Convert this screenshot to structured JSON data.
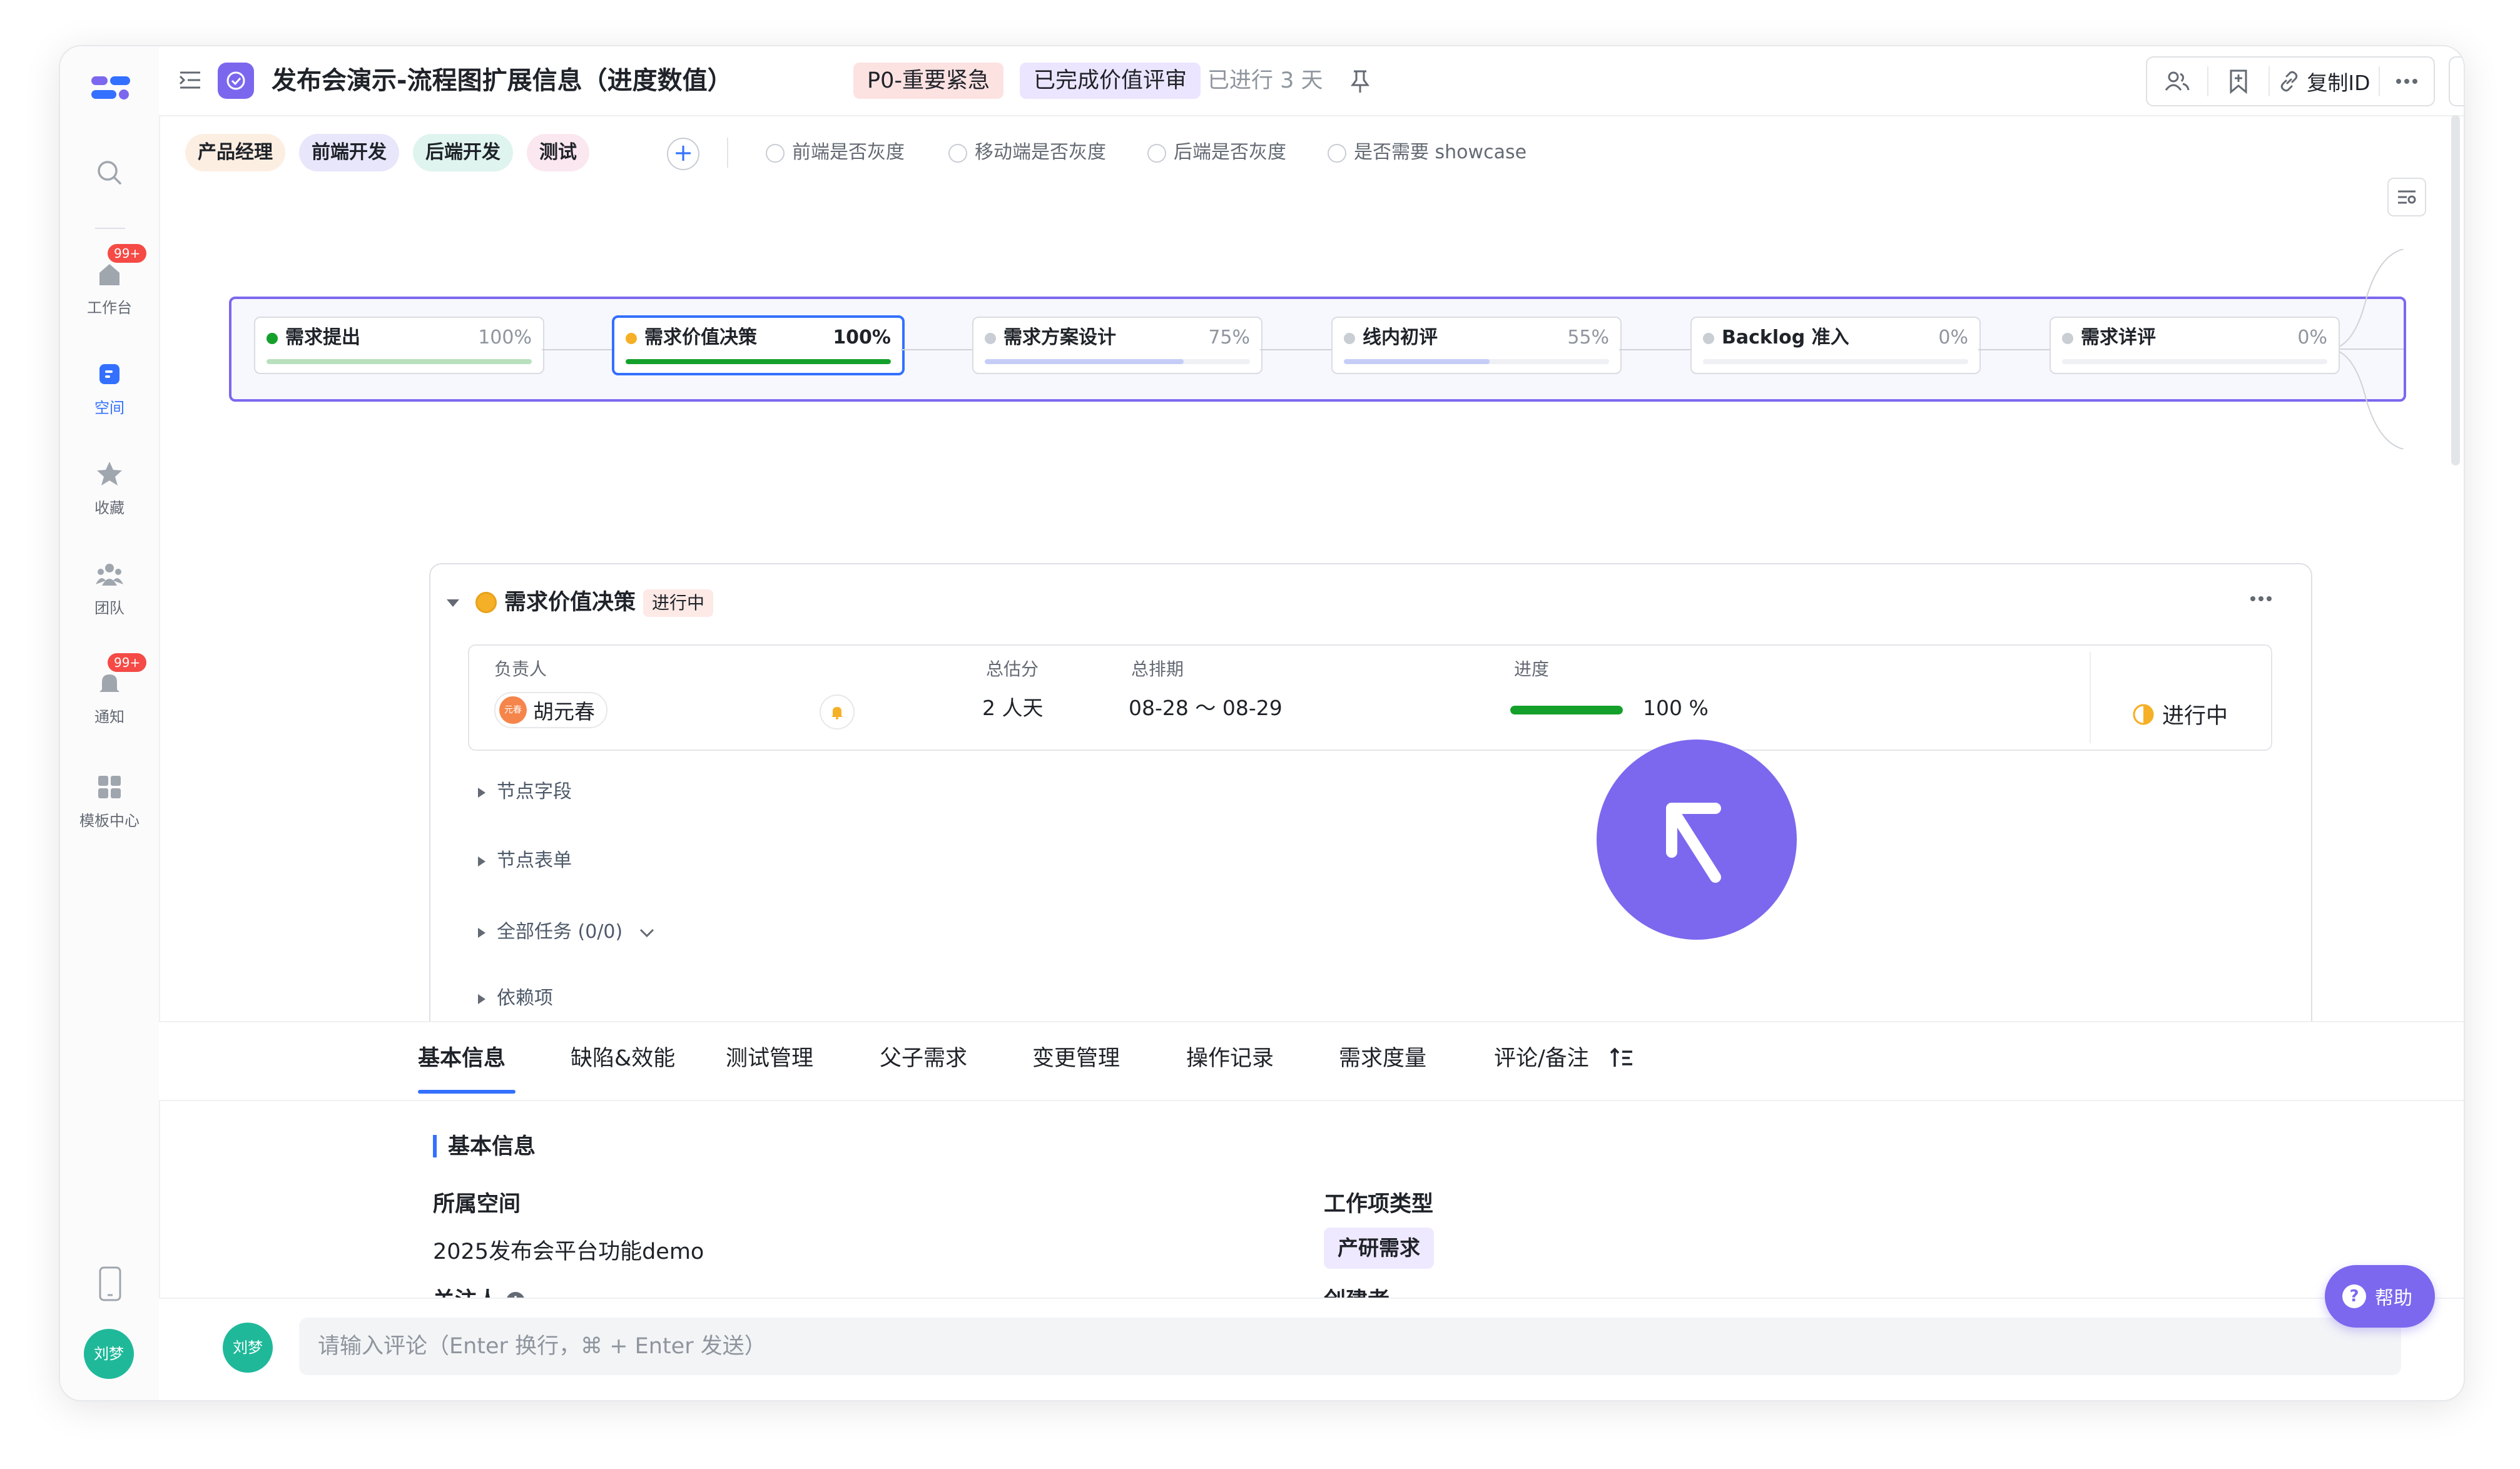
{
  "sidebar": {
    "items": [
      {
        "label": "",
        "icon": "search-icon"
      },
      {
        "label": "工作台",
        "icon": "home-icon",
        "badge": "99+"
      },
      {
        "label": "空间",
        "icon": "space-icon",
        "active": true
      },
      {
        "label": "收藏",
        "icon": "star-icon"
      },
      {
        "label": "团队",
        "icon": "team-icon"
      },
      {
        "label": "通知",
        "icon": "bell-icon",
        "badge": "99+"
      },
      {
        "label": "模板中心",
        "icon": "template-icon"
      }
    ],
    "user_initials": "刘梦"
  },
  "header": {
    "title": "发布会演示-流程图扩展信息（进度数值）",
    "priority_tag": "P0-重要紧急",
    "status_tag": "已完成价值评审",
    "elapsed": "已进行 3 天",
    "copy_id_label": "复制ID"
  },
  "roles": [
    {
      "label": "产品经理",
      "bg": "#fdeee2"
    },
    {
      "label": "前端开发",
      "bg": "#e8e6fb"
    },
    {
      "label": "后端开发",
      "bg": "#dff4ee"
    },
    {
      "label": "测试",
      "bg": "#fbe7f0"
    }
  ],
  "checks": [
    {
      "label": "前端是否灰度"
    },
    {
      "label": "移动端是否灰度"
    },
    {
      "label": "后端是否灰度"
    },
    {
      "label": "是否需要 showcase"
    }
  ],
  "flow": {
    "nodes": [
      {
        "name": "需求提出",
        "pct_label": "100%",
        "progress": 1.0,
        "dot": "#14a02a",
        "fill": "#b8e0bd",
        "active": false
      },
      {
        "name": "需求价值决策",
        "pct_label": "100%",
        "progress": 1.0,
        "dot": "#f5b027",
        "fill": "#14a02a",
        "active": true
      },
      {
        "name": "需求方案设计",
        "pct_label": "75%",
        "progress": 0.75,
        "dot": "#c9cdd4",
        "fill": "#c5cdf7",
        "active": false
      },
      {
        "name": "线内初评",
        "pct_label": "55%",
        "progress": 0.55,
        "dot": "#c9cdd4",
        "fill": "#c5cdf7",
        "active": false
      },
      {
        "name": "Backlog 准入",
        "pct_label": "0%",
        "progress": 0,
        "dot": "#c9cdd4",
        "fill": "#c5cdf7",
        "active": false
      },
      {
        "name": "需求详评",
        "pct_label": "0%",
        "progress": 0,
        "dot": "#c9cdd4",
        "fill": "#c5cdf7",
        "active": false
      }
    ]
  },
  "card": {
    "title": "需求价值决策",
    "status": "进行中",
    "headers": {
      "owner": "负责人",
      "estimate": "总估分",
      "schedule": "总排期",
      "progress": "进度"
    },
    "owner_avatar": "元春",
    "owner": "胡元春",
    "estimate": "2 人天",
    "schedule": "08-28 ～ 08-29",
    "progress_value": 1.0,
    "progress_label": "100 %",
    "right_status": "进行中",
    "sections": [
      "节点字段",
      "节点表单",
      "全部任务 (0/0)",
      "依赖项"
    ]
  },
  "tabs": [
    "基本信息",
    "缺陷&效能",
    "测试管理",
    "父子需求",
    "变更管理",
    "操作记录",
    "需求度量",
    "评论/备注"
  ],
  "basic_info": {
    "heading": "基本信息",
    "space_label": "所属空间",
    "space_value": "2025发布会平台功能demo",
    "type_label": "工作项类型",
    "type_value": "产研需求",
    "watchers_label": "关注人",
    "creator_label": "创建者"
  },
  "comment": {
    "avatar": "刘梦",
    "placeholder": "请输入评论（Enter 换行，⌘ + Enter 发送）"
  },
  "help_label": "帮助",
  "colors": {
    "accent": "#3370ff",
    "brand": "#7b68ee",
    "success": "#14a02a"
  }
}
